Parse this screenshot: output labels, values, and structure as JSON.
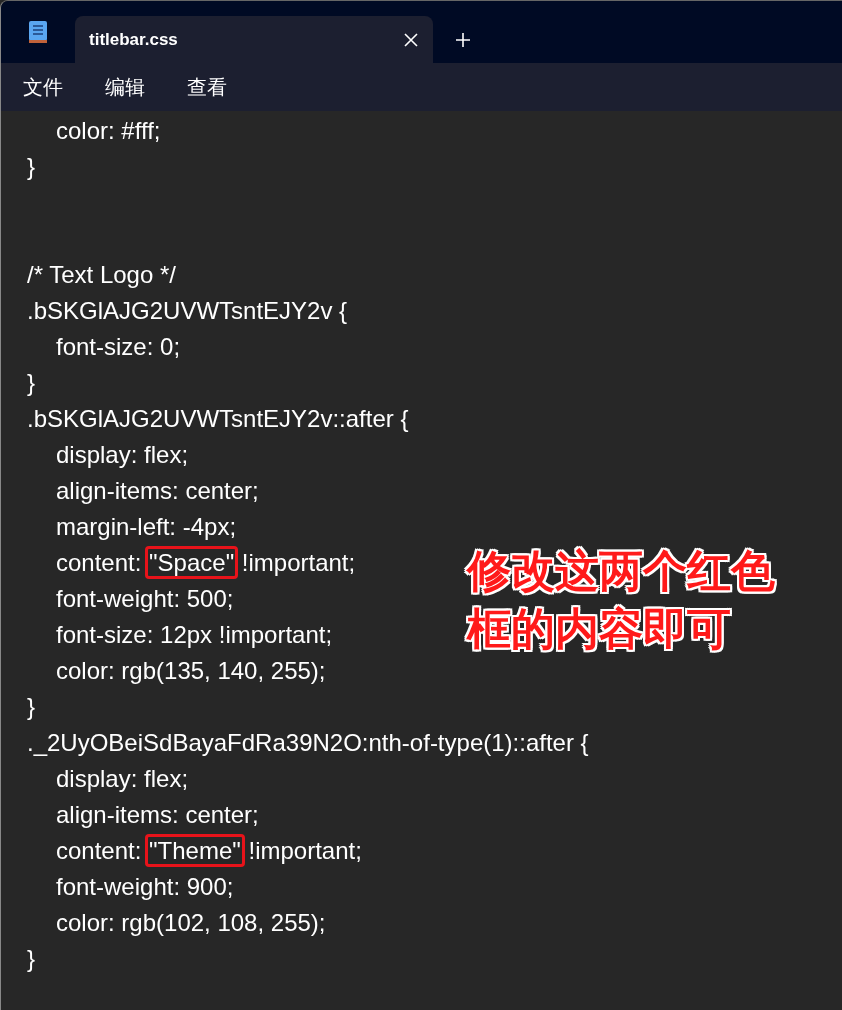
{
  "tabs": [
    {
      "label": "titlebar.css",
      "selected": true
    }
  ],
  "menu": [
    "文件",
    "编辑",
    "查看"
  ],
  "lines": [
    {
      "kind": "code",
      "parts": [
        {
          "text": "\tcolor: #fff;"
        }
      ]
    },
    {
      "kind": "code",
      "parts": [
        {
          "text": "}"
        }
      ]
    },
    {
      "kind": "blank"
    },
    {
      "kind": "blank"
    },
    {
      "kind": "code",
      "parts": [
        {
          "text": "/* Text Logo */"
        }
      ]
    },
    {
      "kind": "code",
      "parts": [
        {
          "text": ".bSKGlAJG2UVWTsntEJY2v {"
        }
      ]
    },
    {
      "kind": "code",
      "parts": [
        {
          "text": "\tfont-size: 0;"
        }
      ]
    },
    {
      "kind": "code",
      "parts": [
        {
          "text": "}"
        }
      ]
    },
    {
      "kind": "code",
      "parts": [
        {
          "text": ".bSKGlAJG2UVWTsntEJY2v::after {"
        }
      ]
    },
    {
      "kind": "code",
      "parts": [
        {
          "text": "\tdisplay: flex;"
        }
      ]
    },
    {
      "kind": "code",
      "parts": [
        {
          "text": "\talign-items: center;"
        }
      ]
    },
    {
      "kind": "code",
      "parts": [
        {
          "text": "\tmargin-left: -4px;"
        }
      ]
    },
    {
      "kind": "code",
      "parts": [
        {
          "text": "\tcontent: "
        },
        {
          "text": "\"Space\"",
          "boxed": true
        },
        {
          "text": " !important;"
        }
      ]
    },
    {
      "kind": "code",
      "parts": [
        {
          "text": "\tfont-weight: 500;"
        }
      ]
    },
    {
      "kind": "code",
      "parts": [
        {
          "text": "\tfont-size: 12px !important;"
        }
      ]
    },
    {
      "kind": "code",
      "parts": [
        {
          "text": "\tcolor: rgb(135, 140, 255);"
        }
      ]
    },
    {
      "kind": "code",
      "parts": [
        {
          "text": "}"
        }
      ]
    },
    {
      "kind": "code",
      "parts": [
        {
          "text": "._2UyOBeiSdBayaFdRa39N2O:nth-of-type(1)::after {"
        }
      ]
    },
    {
      "kind": "code",
      "parts": [
        {
          "text": "\tdisplay: flex;"
        }
      ]
    },
    {
      "kind": "code",
      "parts": [
        {
          "text": "\talign-items: center;"
        }
      ]
    },
    {
      "kind": "code",
      "parts": [
        {
          "text": "\tcontent: "
        },
        {
          "text": "\"Theme\"",
          "boxed": true
        },
        {
          "text": " !important;"
        }
      ]
    },
    {
      "kind": "code",
      "parts": [
        {
          "text": "\tfont-weight: 900;"
        }
      ]
    },
    {
      "kind": "code",
      "parts": [
        {
          "text": "\tcolor: rgb(102, 108, 255);"
        }
      ]
    },
    {
      "kind": "code",
      "parts": [
        {
          "text": "}"
        }
      ]
    }
  ],
  "annotation": [
    "修改这两个红色",
    "框的内容即可"
  ]
}
